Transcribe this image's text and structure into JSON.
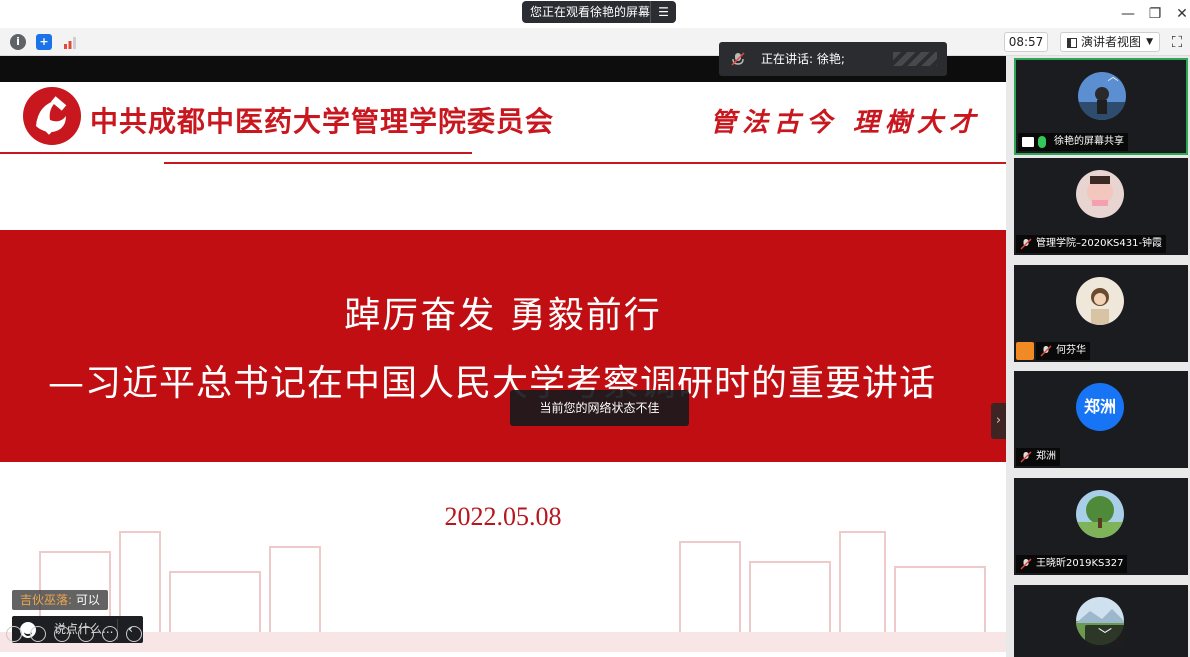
{
  "window": {
    "share_banner": "您正在观看徐艳的屏幕",
    "menu_glyph": "☰",
    "minimize_glyph": "—",
    "restore_glyph": "❐",
    "close_glyph": "✕"
  },
  "toolbar": {
    "info_glyph": "i",
    "shield_glyph": "+",
    "clock": "08:57",
    "view_label": "演讲者视图",
    "view_caret": "▼",
    "fullscreen_glyph": "⛶"
  },
  "speaking": {
    "label": "正在讲话: 徐艳;"
  },
  "slide": {
    "org_title": "中共成都中医药大学管理学院委员会",
    "motto": "管法古今 理樹大才",
    "headline": "踔厉奋发 勇毅前行",
    "subline": "—习近平总书记在中国人民大学考察调研时的重要讲话",
    "date": "2022.05.08"
  },
  "toast": {
    "text": "当前您的网络状态不佳"
  },
  "side_arrow": "›",
  "chat": {
    "sender": "吉伙巫落:",
    "message": " 可以",
    "input_placeholder": "说点什么...",
    "collapse_glyph": "‹"
  },
  "participants": [
    {
      "name": "徐艳的屏幕共享",
      "avatar": "photo",
      "sharing": true
    },
    {
      "name": "管理学院–2020KS431-钟霞",
      "avatar": "photo"
    },
    {
      "name": "何芬华",
      "avatar": "photo",
      "host": true
    },
    {
      "name": "郑洲",
      "avatar": "text",
      "avatar_text": "郑洲"
    },
    {
      "name": "王晓昕2019KS327",
      "avatar": "photo"
    },
    {
      "name": "",
      "avatar": "photo"
    }
  ],
  "panel": {
    "scroll_up_glyph": "︿",
    "scroll_down_glyph": "﹀"
  },
  "colors": {
    "party_red": "#c8171e",
    "band_red": "#c10e12",
    "active_border": "#2fa653",
    "avatar_blue": "#1774f5"
  }
}
